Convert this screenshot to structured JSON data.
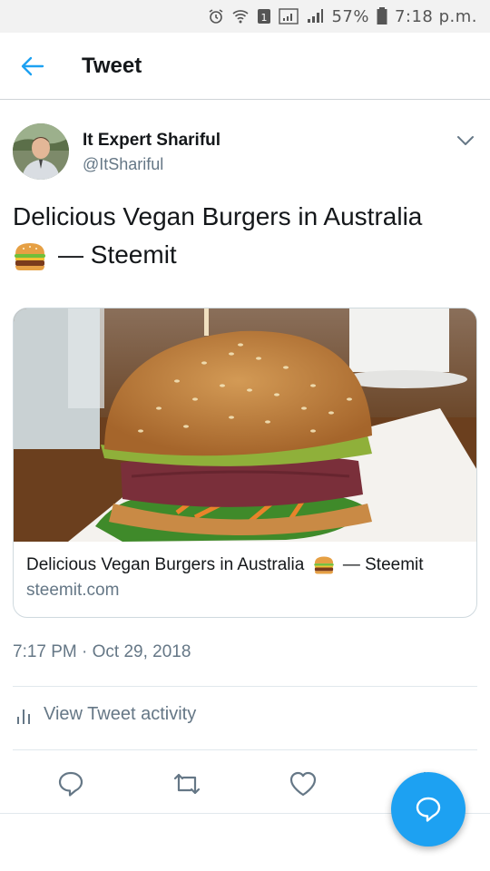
{
  "status_bar": {
    "battery": "57%",
    "time": "7:18 p.m.",
    "sim_label": "1"
  },
  "header": {
    "title": "Tweet"
  },
  "author": {
    "name": "It Expert Shariful",
    "handle": "@ItShariful"
  },
  "tweet": {
    "text_line1": "Delicious Vegan Burgers in Australia",
    "text_line2": "— Steemit",
    "emoji": "hamburger"
  },
  "card": {
    "title_before": "Delicious Vegan Burgers in Australia",
    "title_after": "— Steemit",
    "domain": "steemit.com"
  },
  "timestamp": "7:17 PM · Oct 29, 2018",
  "activity": {
    "label": "View Tweet activity"
  },
  "colors": {
    "accent": "#1da1f2",
    "secondary_text": "#657786",
    "primary_text": "#14171a"
  }
}
